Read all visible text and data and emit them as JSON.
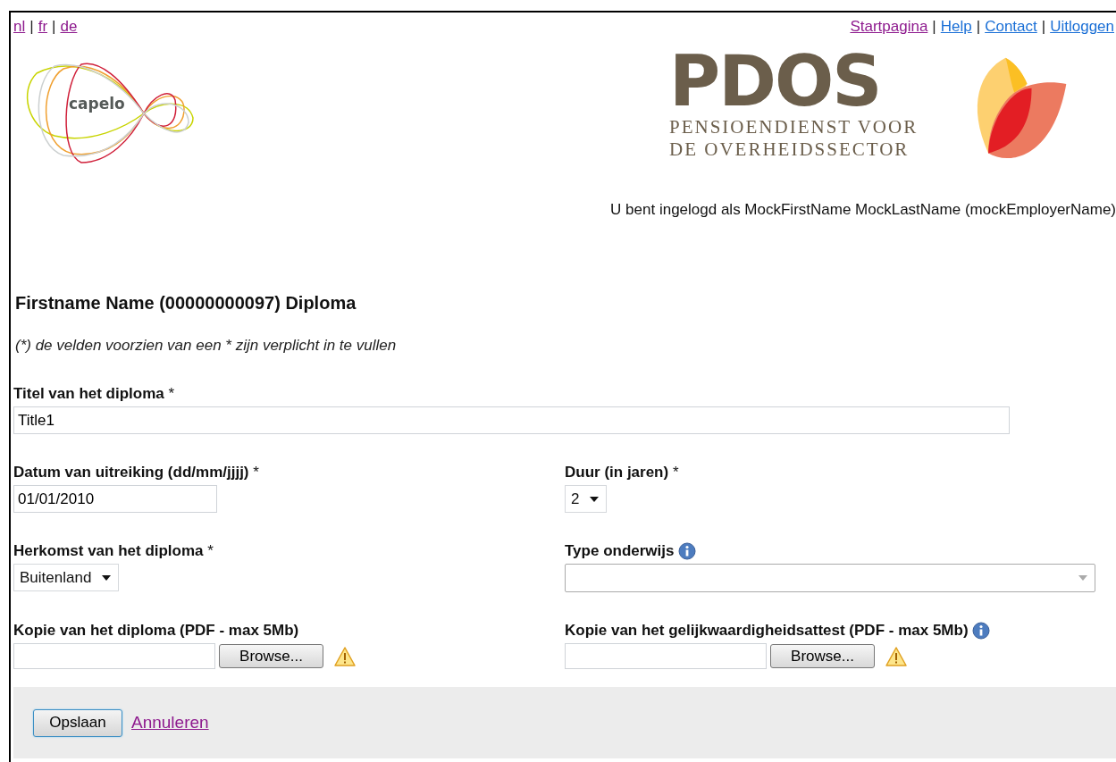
{
  "link_separator": "|",
  "language_links": [
    {
      "label": "nl",
      "visited": true
    },
    {
      "label": "fr",
      "visited": true
    },
    {
      "label": "de",
      "visited": true
    }
  ],
  "top_links": [
    {
      "label": "Startpagina",
      "visited": true
    },
    {
      "label": "Help",
      "visited": false
    },
    {
      "label": "Contact",
      "visited": false
    },
    {
      "label": "Uitloggen",
      "visited": false
    }
  ],
  "logo_left": {
    "text": "capelo"
  },
  "logo_right": {
    "title": "PDOS",
    "subtitle_lines": [
      "PENSIOENDIENST VOOR",
      "DE OVERHEIDSSECTOR"
    ]
  },
  "login_status": "U bent ingelogd als MockFirstName MockLastName (mockEmployerName)",
  "form": {
    "title": "Firstname Name (00000000097) Diploma",
    "note": "(*) de velden voorzien van een * zijn verplicht in te vullen",
    "rows": [
      [
        {
          "kind": "text",
          "label": "**Titel van het diploma** *",
          "value": "Title1",
          "wide": true
        }
      ],
      [
        {
          "kind": "text",
          "label": "**Datum van uitreiking (dd/mm/jjjj)** *",
          "value": "01/01/2010"
        },
        {
          "kind": "select",
          "label": "**Duur (in jaren)** *",
          "value": "2"
        }
      ],
      [
        {
          "kind": "select",
          "label": "**Herkomst van het diploma** *",
          "value": "Buitenland"
        },
        {
          "kind": "combobox",
          "label": "**Type onderwijs**",
          "info": true
        }
      ],
      [
        {
          "kind": "file",
          "label": "**Kopie van het diploma (PDF - max 5Mb)**",
          "button": "Browse...",
          "warning": true
        },
        {
          "kind": "file",
          "label": "**Kopie van het gelijkwaardigheidsattest (PDF - max 5Mb)**",
          "info": true,
          "button": "Browse...",
          "warning": true
        }
      ]
    ]
  },
  "actions": [
    {
      "kind": "button",
      "label": "Opslaan"
    },
    {
      "kind": "link",
      "label": "Annuleren",
      "visited": true
    }
  ]
}
